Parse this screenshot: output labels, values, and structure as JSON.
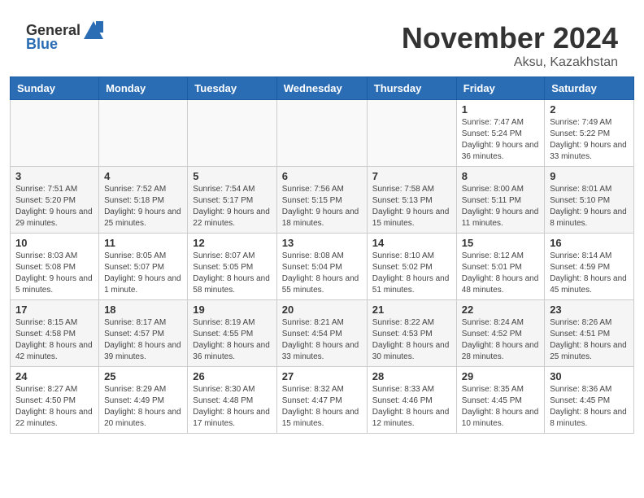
{
  "header": {
    "logo_general": "General",
    "logo_blue": "Blue",
    "month_year": "November 2024",
    "location": "Aksu, Kazakhstan"
  },
  "columns": [
    "Sunday",
    "Monday",
    "Tuesday",
    "Wednesday",
    "Thursday",
    "Friday",
    "Saturday"
  ],
  "weeks": [
    {
      "days": [
        {
          "num": "",
          "info": ""
        },
        {
          "num": "",
          "info": ""
        },
        {
          "num": "",
          "info": ""
        },
        {
          "num": "",
          "info": ""
        },
        {
          "num": "",
          "info": ""
        },
        {
          "num": "1",
          "info": "Sunrise: 7:47 AM\nSunset: 5:24 PM\nDaylight: 9 hours and 36 minutes."
        },
        {
          "num": "2",
          "info": "Sunrise: 7:49 AM\nSunset: 5:22 PM\nDaylight: 9 hours and 33 minutes."
        }
      ]
    },
    {
      "days": [
        {
          "num": "3",
          "info": "Sunrise: 7:51 AM\nSunset: 5:20 PM\nDaylight: 9 hours and 29 minutes."
        },
        {
          "num": "4",
          "info": "Sunrise: 7:52 AM\nSunset: 5:18 PM\nDaylight: 9 hours and 25 minutes."
        },
        {
          "num": "5",
          "info": "Sunrise: 7:54 AM\nSunset: 5:17 PM\nDaylight: 9 hours and 22 minutes."
        },
        {
          "num": "6",
          "info": "Sunrise: 7:56 AM\nSunset: 5:15 PM\nDaylight: 9 hours and 18 minutes."
        },
        {
          "num": "7",
          "info": "Sunrise: 7:58 AM\nSunset: 5:13 PM\nDaylight: 9 hours and 15 minutes."
        },
        {
          "num": "8",
          "info": "Sunrise: 8:00 AM\nSunset: 5:11 PM\nDaylight: 9 hours and 11 minutes."
        },
        {
          "num": "9",
          "info": "Sunrise: 8:01 AM\nSunset: 5:10 PM\nDaylight: 9 hours and 8 minutes."
        }
      ]
    },
    {
      "days": [
        {
          "num": "10",
          "info": "Sunrise: 8:03 AM\nSunset: 5:08 PM\nDaylight: 9 hours and 5 minutes."
        },
        {
          "num": "11",
          "info": "Sunrise: 8:05 AM\nSunset: 5:07 PM\nDaylight: 9 hours and 1 minute."
        },
        {
          "num": "12",
          "info": "Sunrise: 8:07 AM\nSunset: 5:05 PM\nDaylight: 8 hours and 58 minutes."
        },
        {
          "num": "13",
          "info": "Sunrise: 8:08 AM\nSunset: 5:04 PM\nDaylight: 8 hours and 55 minutes."
        },
        {
          "num": "14",
          "info": "Sunrise: 8:10 AM\nSunset: 5:02 PM\nDaylight: 8 hours and 51 minutes."
        },
        {
          "num": "15",
          "info": "Sunrise: 8:12 AM\nSunset: 5:01 PM\nDaylight: 8 hours and 48 minutes."
        },
        {
          "num": "16",
          "info": "Sunrise: 8:14 AM\nSunset: 4:59 PM\nDaylight: 8 hours and 45 minutes."
        }
      ]
    },
    {
      "days": [
        {
          "num": "17",
          "info": "Sunrise: 8:15 AM\nSunset: 4:58 PM\nDaylight: 8 hours and 42 minutes."
        },
        {
          "num": "18",
          "info": "Sunrise: 8:17 AM\nSunset: 4:57 PM\nDaylight: 8 hours and 39 minutes."
        },
        {
          "num": "19",
          "info": "Sunrise: 8:19 AM\nSunset: 4:55 PM\nDaylight: 8 hours and 36 minutes."
        },
        {
          "num": "20",
          "info": "Sunrise: 8:21 AM\nSunset: 4:54 PM\nDaylight: 8 hours and 33 minutes."
        },
        {
          "num": "21",
          "info": "Sunrise: 8:22 AM\nSunset: 4:53 PM\nDaylight: 8 hours and 30 minutes."
        },
        {
          "num": "22",
          "info": "Sunrise: 8:24 AM\nSunset: 4:52 PM\nDaylight: 8 hours and 28 minutes."
        },
        {
          "num": "23",
          "info": "Sunrise: 8:26 AM\nSunset: 4:51 PM\nDaylight: 8 hours and 25 minutes."
        }
      ]
    },
    {
      "days": [
        {
          "num": "24",
          "info": "Sunrise: 8:27 AM\nSunset: 4:50 PM\nDaylight: 8 hours and 22 minutes."
        },
        {
          "num": "25",
          "info": "Sunrise: 8:29 AM\nSunset: 4:49 PM\nDaylight: 8 hours and 20 minutes."
        },
        {
          "num": "26",
          "info": "Sunrise: 8:30 AM\nSunset: 4:48 PM\nDaylight: 8 hours and 17 minutes."
        },
        {
          "num": "27",
          "info": "Sunrise: 8:32 AM\nSunset: 4:47 PM\nDaylight: 8 hours and 15 minutes."
        },
        {
          "num": "28",
          "info": "Sunrise: 8:33 AM\nSunset: 4:46 PM\nDaylight: 8 hours and 12 minutes."
        },
        {
          "num": "29",
          "info": "Sunrise: 8:35 AM\nSunset: 4:45 PM\nDaylight: 8 hours and 10 minutes."
        },
        {
          "num": "30",
          "info": "Sunrise: 8:36 AM\nSunset: 4:45 PM\nDaylight: 8 hours and 8 minutes."
        }
      ]
    }
  ]
}
